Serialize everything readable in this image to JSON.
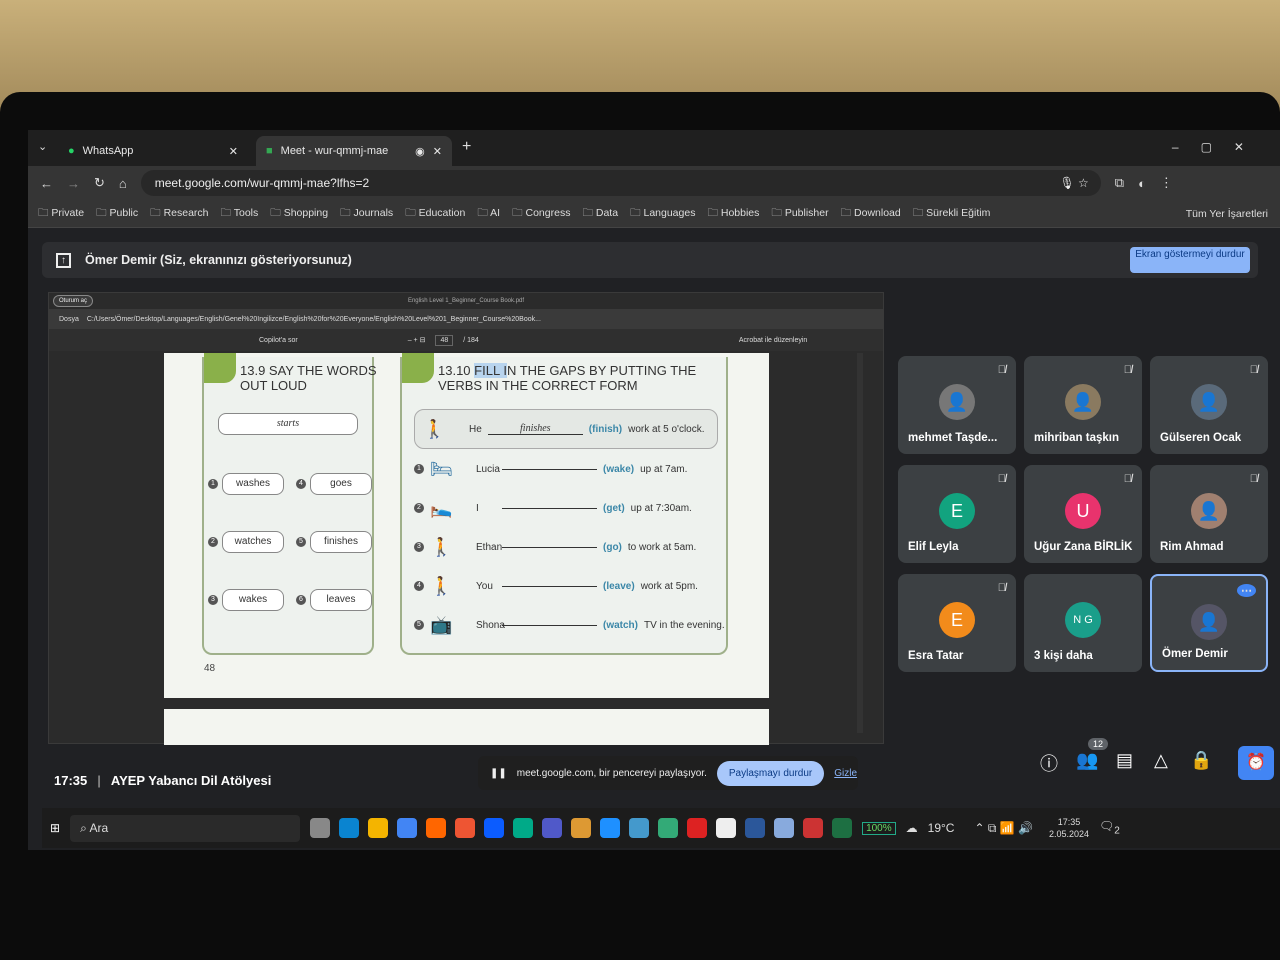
{
  "browser": {
    "tabs": [
      {
        "label": "WhatsApp"
      },
      {
        "label": "Meet - wur-qmmj-mae"
      }
    ],
    "url": "meet.google.com/wur-qmmj-mae?lfhs=2",
    "bookmarks": [
      "Private",
      "Public",
      "Research",
      "Tools",
      "Shopping",
      "Journals",
      "Education",
      "AI",
      "Congress",
      "Data",
      "Languages",
      "Hobbies",
      "Publisher",
      "Download",
      "Sürekli Eğitim"
    ],
    "all_bookmarks": "Tüm Yer İşaretleri"
  },
  "share": {
    "presenter": "Ömer Demir (Siz, ekranınızı gösteriyorsunuz)",
    "stop_label": "Ekran göstermeyi durdur"
  },
  "pdf": {
    "title": "English Level 1_Beginner_Course Book.pdf",
    "profile": "Oturum aç",
    "file_label": "Dosya",
    "path": "C:/Users/Ömer/Desktop/Languages/English/Genel%20Ingilizce/English%20for%20Everyone/English%20Level%201_Beginner_Course%20Book...",
    "copilot": "Copilot'a sor",
    "page": "48",
    "total": "/ 184",
    "acrobat": "Acrobat ile düzenleyin",
    "page_number": "48",
    "ex1": {
      "title": "13.9 SAY THE WORDS OUT LOUD",
      "example": "starts",
      "items": [
        [
          "1",
          "washes"
        ],
        [
          "4",
          "goes"
        ],
        [
          "2",
          "watches"
        ],
        [
          "5",
          "finishes"
        ],
        [
          "3",
          "wakes"
        ],
        [
          "6",
          "leaves"
        ]
      ]
    },
    "ex2": {
      "num": "13.10",
      "title_hl": "FILL I",
      "title_rest": "N THE GAPS BY PUTTING THE VERBS IN THE CORRECT FORM",
      "example": {
        "subject": "He",
        "answer": "finishes",
        "verb": "(finish)",
        "rest": "work at 5 o'clock."
      },
      "rows": [
        {
          "n": "1",
          "subject": "Lucia",
          "verb": "(wake)",
          "rest": "up at 7am."
        },
        {
          "n": "2",
          "subject": "I",
          "verb": "(get)",
          "rest": "up at 7:30am."
        },
        {
          "n": "3",
          "subject": "Ethan",
          "verb": "(go)",
          "rest": "to work at 5am."
        },
        {
          "n": "4",
          "subject": "You",
          "verb": "(leave)",
          "rest": "work at 5pm."
        },
        {
          "n": "5",
          "subject": "Shona",
          "verb": "(watch)",
          "rest": "TV in the evening."
        }
      ]
    }
  },
  "participants": [
    {
      "name": "mehmet Taşde...",
      "initial": "",
      "color": "#777"
    },
    {
      "name": "mihriban taşkın",
      "initial": "",
      "color": "#8a7a60"
    },
    {
      "name": "Gülseren Ocak",
      "initial": "",
      "color": "#5a6a7a"
    },
    {
      "name": "Elif Leyla",
      "initial": "E",
      "color": "#12a37f"
    },
    {
      "name": "Uğur Zana BİRLİK",
      "initial": "U",
      "color": "#e8336d"
    },
    {
      "name": "Rim Ahmad",
      "initial": "",
      "color": "#a08070"
    },
    {
      "name": "Esra Tatar",
      "initial": "E",
      "color": "#f28b1b"
    },
    {
      "name": "3 kişi daha",
      "initial": "N G",
      "color": "#1a9e8a"
    },
    {
      "name": "Ömer Demir",
      "initial": "",
      "color": "#556"
    }
  ],
  "meeting": {
    "time": "17:35",
    "name": "AYEP Yabancı Dil Atölyesi",
    "people_count": "12"
  },
  "share_notice": {
    "text": "meet.google.com, bir pencereyi paylaşıyor.",
    "stop": "Paylaşmayı durdur",
    "hide": "Gizle"
  },
  "taskbar": {
    "search": "Ara",
    "battery": "100%",
    "weather": "19°C",
    "clock": "17:35",
    "date": "2.05.2024",
    "notif": "2"
  }
}
